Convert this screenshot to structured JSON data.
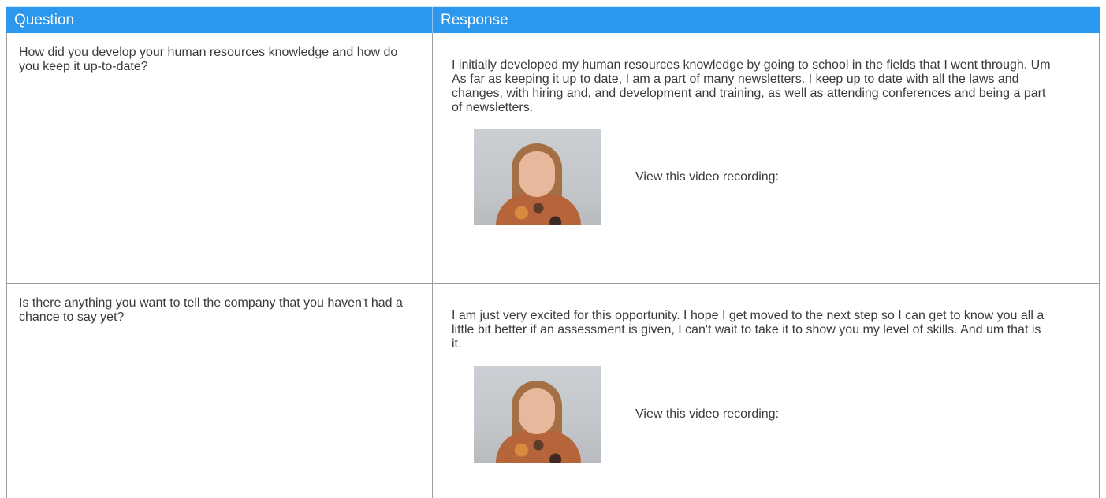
{
  "headers": {
    "question": "Question",
    "response": "Response"
  },
  "rows": [
    {
      "question": "How did you develop your human resources knowledge and how do you keep it up-to-date?",
      "response": "I initially developed my human resources knowledge by going to school in the fields that I went through. Um As far as keeping it up to date, I am a part of many newsletters. I keep up to date with all the laws and changes, with hiring and, and development and training, as well as attending conferences and being a part of newsletters.",
      "video_label": "View this video recording:"
    },
    {
      "question": "Is there anything you want to tell the company that you haven't had a chance to say yet?",
      "response": "I am just very excited for this opportunity. I hope I get moved to the next step so I can get to know you all a little bit better if an assessment is given, I can't wait to take it to show you my level of skills. And um that is it.",
      "video_label": "View this video recording:"
    }
  ],
  "colors": {
    "header_bg": "#2b98ee",
    "header_text": "#ffffff",
    "border": "#9c9c9c",
    "text": "#3a3a3a"
  }
}
